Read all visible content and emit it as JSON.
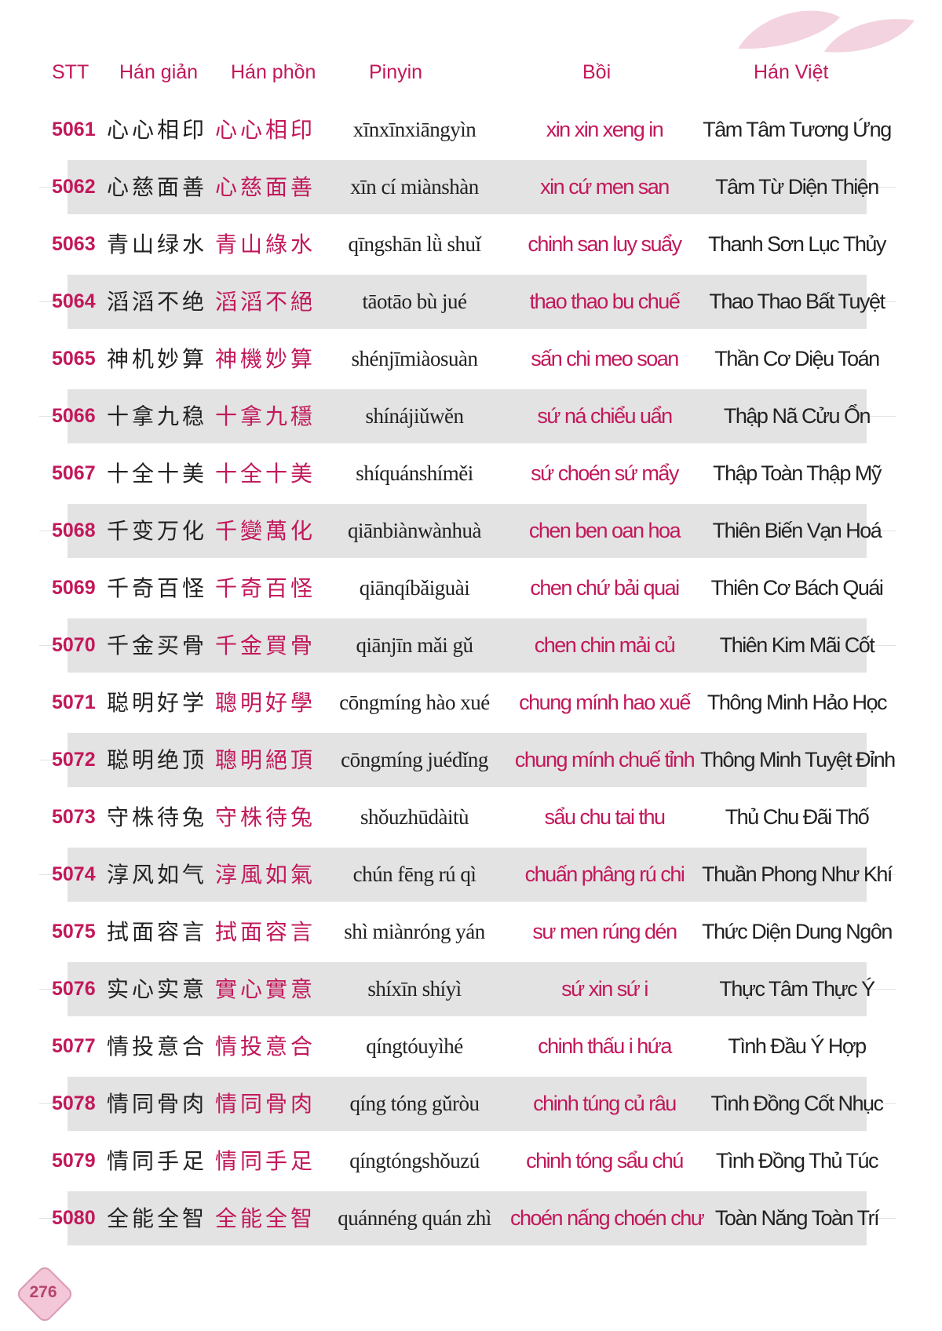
{
  "header": {
    "stt": "STT",
    "han_gian": "Hán giản",
    "han_phon": "Hán phồn",
    "pinyin": "Pinyin",
    "boi": "Bồi",
    "han_viet": "Hán Việt"
  },
  "rows": [
    {
      "stt": "5061",
      "han_gian": "心心相印",
      "han_phon": "心心相印",
      "pinyin": "xīnxīnxiāngyìn",
      "boi": "xin xin xeng in",
      "han_viet": "Tâm Tâm Tương Ứng"
    },
    {
      "stt": "5062",
      "han_gian": "心慈面善",
      "han_phon": "心慈面善",
      "pinyin": "xīn cí miànshàn",
      "boi": "xin cứ men san",
      "han_viet": "Tâm Từ Diện Thiện"
    },
    {
      "stt": "5063",
      "han_gian": "青山绿水",
      "han_phon": "青山綠水",
      "pinyin": "qīngshān lǜ shuǐ",
      "boi": "chinh san luy suẩy",
      "han_viet": "Thanh Sơn Lục Thủy"
    },
    {
      "stt": "5064",
      "han_gian": "滔滔不绝",
      "han_phon": "滔滔不絕",
      "pinyin": "tāotāo bù jué",
      "boi": "thao thao bu chuế",
      "han_viet": "Thao Thao Bất Tuyệt"
    },
    {
      "stt": "5065",
      "han_gian": "神机妙算",
      "han_phon": "神機妙算",
      "pinyin": "shénjīmiàosuàn",
      "boi": "sấn chi meo soan",
      "han_viet": "Thần Cơ Diệu Toán"
    },
    {
      "stt": "5066",
      "han_gian": "十拿九稳",
      "han_phon": "十拿九穩",
      "pinyin": "shínájiǔwěn",
      "boi": "sứ ná chiểu uẩn",
      "han_viet": "Thập Nã Cửu Ổn"
    },
    {
      "stt": "5067",
      "han_gian": "十全十美",
      "han_phon": "十全十美",
      "pinyin": "shíquánshíměi",
      "boi": "sứ choén sứ mẩy",
      "han_viet": "Thập Toàn Thập Mỹ"
    },
    {
      "stt": "5068",
      "han_gian": "千变万化",
      "han_phon": "千變萬化",
      "pinyin": "qiānbiànwànhuà",
      "boi": "chen ben oan hoa",
      "han_viet": "Thiên Biến Vạn Hoá"
    },
    {
      "stt": "5069",
      "han_gian": "千奇百怪",
      "han_phon": "千奇百怪",
      "pinyin": "qiānqíbǎiguài",
      "boi": "chen chứ bải quai",
      "han_viet": "Thiên Cơ Bách Quái"
    },
    {
      "stt": "5070",
      "han_gian": "千金买骨",
      "han_phon": "千金買骨",
      "pinyin": "qiānjīn mǎi gǔ",
      "boi": "chen chin mải củ",
      "han_viet": "Thiên Kim Mãi Cốt"
    },
    {
      "stt": "5071",
      "han_gian": "聪明好学",
      "han_phon": "聰明好學",
      "pinyin": "cōngmíng hào xué",
      "boi": "chung mính hao xuế",
      "han_viet": "Thông Minh Hảo Học"
    },
    {
      "stt": "5072",
      "han_gian": "聪明绝顶",
      "han_phon": "聰明絕頂",
      "pinyin": "cōngmíng juédǐng",
      "boi": "chung mính chuế tỉnh",
      "han_viet": "Thông Minh Tuyệt Đỉnh"
    },
    {
      "stt": "5073",
      "han_gian": "守株待兔",
      "han_phon": "守株待兔",
      "pinyin": "shǒuzhūdàitù",
      "boi": "sẩu chu tai thu",
      "han_viet": "Thủ Chu Đãi Thố"
    },
    {
      "stt": "5074",
      "han_gian": "淳风如气",
      "han_phon": "淳風如氣",
      "pinyin": "chún fēng rú qì",
      "boi": "chuấn phâng rú chi",
      "han_viet": "Thuần Phong Như Khí"
    },
    {
      "stt": "5075",
      "han_gian": "拭面容言",
      "han_phon": "拭面容言",
      "pinyin": "shì miànróng yán",
      "boi": "sư men rúng dén",
      "han_viet": "Thức Diện Dung Ngôn"
    },
    {
      "stt": "5076",
      "han_gian": "实心实意",
      "han_phon": "實心實意",
      "pinyin": "shíxīn shíyì",
      "boi": "sứ xin sứ i",
      "han_viet": "Thực Tâm Thực Ý"
    },
    {
      "stt": "5077",
      "han_gian": "情投意合",
      "han_phon": "情投意合",
      "pinyin": "qíngtóuyìhé",
      "boi": "chinh thấu i hứa",
      "han_viet": "Tình Đầu Ý Hợp"
    },
    {
      "stt": "5078",
      "han_gian": "情同骨肉",
      "han_phon": "情同骨肉",
      "pinyin": "qíng tóng gǔròu",
      "boi": "chinh túng củ râu",
      "han_viet": "Tình Đồng Cốt Nhục"
    },
    {
      "stt": "5079",
      "han_gian": "情同手足",
      "han_phon": "情同手足",
      "pinyin": "qíngtóngshǒuzú",
      "boi": "chinh tóng sẩu chú",
      "han_viet": "Tình Đồng Thủ Túc"
    },
    {
      "stt": "5080",
      "han_gian": "全能全智",
      "han_phon": "全能全智",
      "pinyin": "quánnéng quán zhì",
      "boi": "choén nấng choén chư",
      "han_viet": "Toàn Năng Toàn Trí"
    }
  ],
  "page_number": "276",
  "colors": {
    "accent": "#c2185b",
    "row_shade": "#e3e3e3",
    "text": "#222222"
  }
}
